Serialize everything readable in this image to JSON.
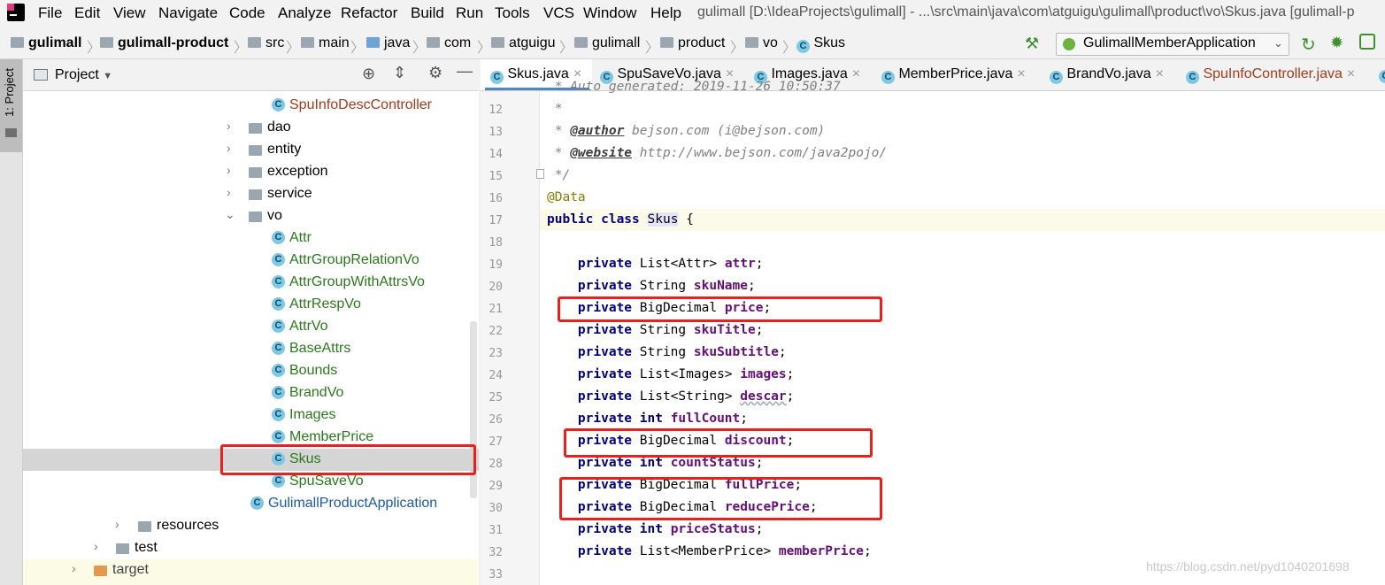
{
  "menubar": {
    "items": [
      "File",
      "Edit",
      "View",
      "Navigate",
      "Code",
      "Analyze",
      "Refactor",
      "Build",
      "Run",
      "Tools",
      "VCS",
      "Window",
      "Help"
    ],
    "title": "gulimall [D:\\IdeaProjects\\gulimall] - ...\\src\\main\\java\\com\\atguigu\\gulimall\\product\\vo\\Skus.java [gulimall-p"
  },
  "breadcrumb": [
    "gulimall",
    "gulimall-product",
    "src",
    "main",
    "java",
    "com",
    "atguigu",
    "gulimall",
    "product",
    "vo",
    "Skus"
  ],
  "run_config": "GulimallMemberApplication",
  "left_strip": {
    "label": "1: Project"
  },
  "project": {
    "title": "Project",
    "tree": [
      {
        "label": "SpuInfoDescController",
        "kind": "class",
        "color": "brown"
      },
      {
        "label": "dao",
        "kind": "folder",
        "arrow": ">"
      },
      {
        "label": "entity",
        "kind": "folder",
        "arrow": ">"
      },
      {
        "label": "exception",
        "kind": "folder",
        "arrow": ">"
      },
      {
        "label": "service",
        "kind": "folder",
        "arrow": ">"
      },
      {
        "label": "vo",
        "kind": "folder",
        "arrow": "v"
      },
      {
        "label": "Attr",
        "kind": "class",
        "color": "green"
      },
      {
        "label": "AttrGroupRelationVo",
        "kind": "class",
        "color": "green"
      },
      {
        "label": "AttrGroupWithAttrsVo",
        "kind": "class",
        "color": "green"
      },
      {
        "label": "AttrRespVo",
        "kind": "class",
        "color": "green"
      },
      {
        "label": "AttrVo",
        "kind": "class",
        "color": "green"
      },
      {
        "label": "BaseAttrs",
        "kind": "class",
        "color": "green"
      },
      {
        "label": "Bounds",
        "kind": "class",
        "color": "green"
      },
      {
        "label": "BrandVo",
        "kind": "class",
        "color": "green"
      },
      {
        "label": "Images",
        "kind": "class",
        "color": "green"
      },
      {
        "label": "MemberPrice",
        "kind": "class",
        "color": "green"
      },
      {
        "label": "Skus",
        "kind": "class",
        "color": "green",
        "selected": true
      },
      {
        "label": "SpuSaveVo",
        "kind": "class",
        "color": "green"
      },
      {
        "label": "GulimallProductApplication",
        "kind": "app",
        "color": "blue"
      },
      {
        "label": "resources",
        "kind": "folder",
        "arrow": ">"
      },
      {
        "label": "test",
        "kind": "folder",
        "arrow": ">"
      },
      {
        "label": "target",
        "kind": "folder",
        "arrow": ">"
      }
    ]
  },
  "tabs": [
    "Skus.java",
    "SpuSaveVo.java",
    "Images.java",
    "MemberPrice.java",
    "BrandVo.java",
    "SpuInfoController.java"
  ],
  "code": {
    "line_numbers": [
      "12",
      "13",
      "14",
      "15",
      "16",
      "17",
      "18",
      "19",
      "20",
      "21",
      "22",
      "23",
      "24",
      "25",
      "26",
      "27",
      "28",
      "29",
      "30",
      "31",
      "32",
      "33"
    ],
    "comment_top": " * Auto generated: 2019-11-26 10:50:37",
    "l12": " *",
    "l13_author": "@author",
    "l13_rest": " bejson.com (i@bejson.com)",
    "l14_website": "@website",
    "l14_rest": " http://www.bejson.com/java2pojo/",
    "l15": " */",
    "l16": "@Data",
    "l17_kw": "public class",
    "l17_name": "Skus",
    "l17_brace": " {",
    "fields": [
      {
        "type": "List<Attr>",
        "name": "attr",
        "prim": false
      },
      {
        "type": "String",
        "name": "skuName",
        "prim": false
      },
      {
        "type": "BigDecimal",
        "name": "price",
        "prim": false
      },
      {
        "type": "String",
        "name": "skuTitle",
        "prim": false
      },
      {
        "type": "String",
        "name": "skuSubtitle",
        "prim": false
      },
      {
        "type": "List<Images>",
        "name": "images",
        "prim": false
      },
      {
        "type": "List<String>",
        "name": "descar",
        "prim": false
      },
      {
        "type": "int",
        "name": "fullCount",
        "prim": true
      },
      {
        "type": "BigDecimal",
        "name": "discount",
        "prim": false
      },
      {
        "type": "int",
        "name": "countStatus",
        "prim": true
      },
      {
        "type": "BigDecimal",
        "name": "fullPrice",
        "prim": false
      },
      {
        "type": "BigDecimal",
        "name": "reducePrice",
        "prim": false
      },
      {
        "type": "int",
        "name": "priceStatus",
        "prim": true
      },
      {
        "type": "List<MemberPrice>",
        "name": "memberPrice",
        "prim": false
      }
    ],
    "private_kw": "private"
  },
  "watermark": "https://blog.csdn.net/pyd1040201698"
}
